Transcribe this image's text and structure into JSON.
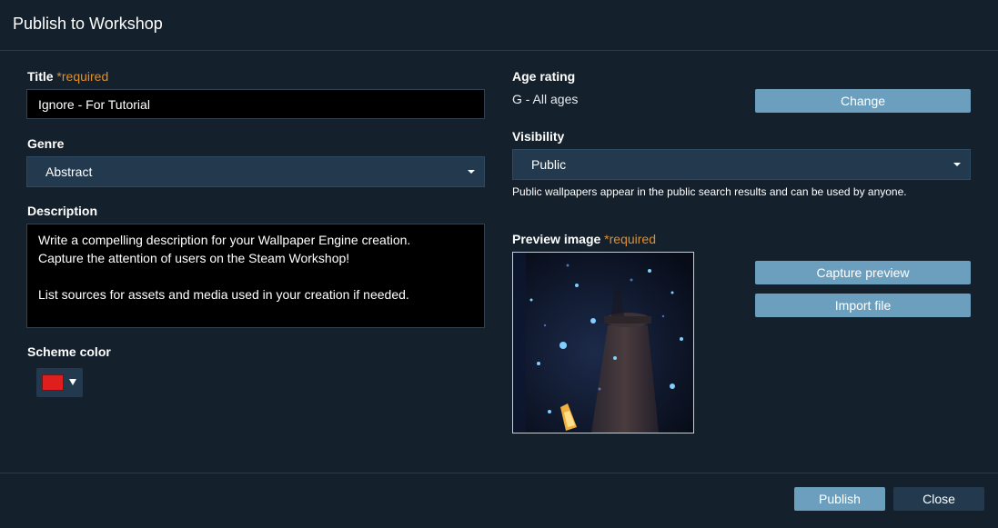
{
  "dialog": {
    "title": "Publish to Workshop"
  },
  "title_field": {
    "label": "Title",
    "required": "*required",
    "value": "Ignore - For Tutorial"
  },
  "genre": {
    "label": "Genre",
    "value": "Abstract"
  },
  "description": {
    "label": "Description",
    "placeholder": "Write a compelling description for your Wallpaper Engine creation.\nCapture the attention of users on the Steam Workshop!\n\nList sources for assets and media used in your creation if needed."
  },
  "scheme_color": {
    "label": "Scheme color",
    "color": "#e01e1e"
  },
  "age_rating": {
    "label": "Age rating",
    "value": "G - All ages",
    "change_button": "Change"
  },
  "visibility": {
    "label": "Visibility",
    "value": "Public",
    "hint": "Public wallpapers appear in the public search results and can be used by anyone."
  },
  "preview_image": {
    "label": "Preview image",
    "required": "*required",
    "capture_button": "Capture preview",
    "import_button": "Import file"
  },
  "footer": {
    "publish_button": "Publish",
    "close_button": "Close"
  },
  "theme": {
    "background": "#14202b",
    "button_blue": "#6c9fbd",
    "button_dark": "#233a4e",
    "required_orange": "#e08f2a"
  }
}
